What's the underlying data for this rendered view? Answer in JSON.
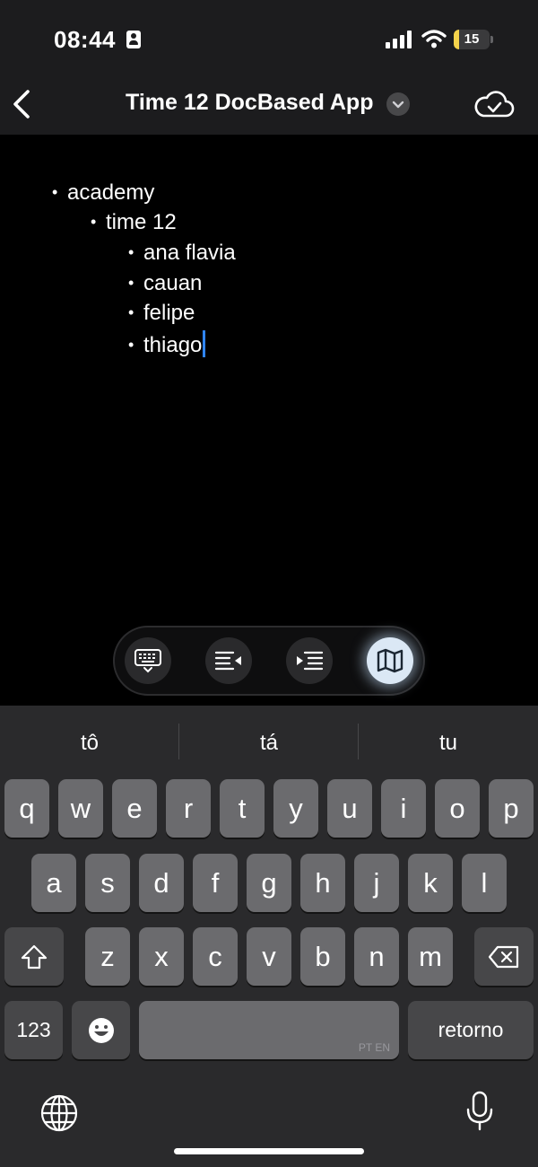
{
  "status_bar": {
    "time": "08:44",
    "battery": "15"
  },
  "nav": {
    "title": "Time 12 DocBased App"
  },
  "document": {
    "lines": [
      {
        "text": "academy",
        "bullet": "•"
      },
      {
        "text": "time 12",
        "bullet": "•"
      },
      {
        "text": "ana flavia",
        "bullet": "•"
      },
      {
        "text": "cauan",
        "bullet": "•"
      },
      {
        "text": "felipe",
        "bullet": "•"
      },
      {
        "text": "thiago",
        "bullet": "•"
      }
    ]
  },
  "toolbar": {
    "buttons": [
      {
        "name": "keyboard-dismiss",
        "icon": "keyboard-icon"
      },
      {
        "name": "outdent",
        "icon": "outdent-icon"
      },
      {
        "name": "indent",
        "icon": "indent-icon"
      },
      {
        "name": "map",
        "icon": "map-icon",
        "active": true
      }
    ]
  },
  "keyboard": {
    "suggestions": [
      "tô",
      "tá",
      "tu"
    ],
    "row1": [
      "q",
      "w",
      "e",
      "r",
      "t",
      "y",
      "u",
      "i",
      "o",
      "p"
    ],
    "row2": [
      "a",
      "s",
      "d",
      "f",
      "g",
      "h",
      "j",
      "k",
      "l"
    ],
    "row3": [
      "z",
      "x",
      "c",
      "v",
      "b",
      "n",
      "m"
    ],
    "numbers_label": "123",
    "space_language": "PT EN",
    "return_label": "retorno"
  },
  "colors": {
    "background": "#000000",
    "bar": "#1c1c1e",
    "keyboard": "#2a2a2c",
    "key": "#6b6b6e",
    "caret": "#2f84ff",
    "battery": "#f5d34b"
  }
}
